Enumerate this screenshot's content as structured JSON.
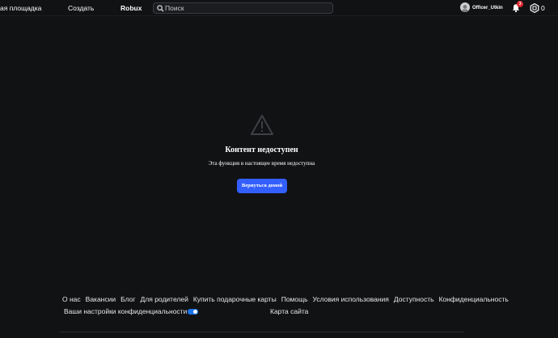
{
  "nav": {
    "marketplace": "ая площадка",
    "create": "Создать",
    "robux": "Robux"
  },
  "search": {
    "placeholder": "Поиск",
    "value": ""
  },
  "user": {
    "name": "Officer_Utkin",
    "notifications_count": "3",
    "robux_balance": "0"
  },
  "content": {
    "icon": "warning-icon",
    "title": "Контент недоступен",
    "message": "Эта функция в настоящее время недоступна",
    "button_label": "Вернуться домой"
  },
  "footer": {
    "links": [
      "О нас",
      "Вакансии",
      "Блог",
      "Для родителей",
      "Купить подарочные карты",
      "Помощь",
      "Условия использования",
      "Доступность",
      "Конфиденциальность"
    ],
    "privacy_settings": "Ваши настройки конфиденциальности",
    "sitemap": "Карта сайта"
  },
  "colors": {
    "background": "#111214",
    "accent": "#335fff",
    "badge": "#e0262d",
    "privacy_toggle": "#1a73e8"
  }
}
